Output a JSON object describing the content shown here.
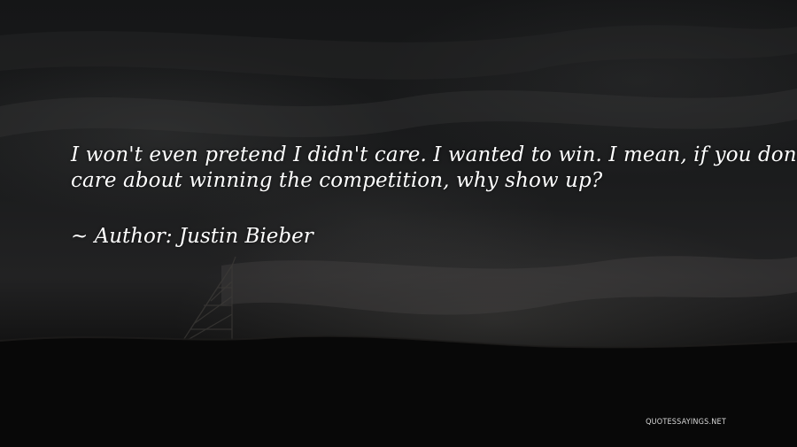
{
  "quote": {
    "lines": [
      "I won't even pretend I didn't care. I wanted to win. I mean, if you don't",
      "care about winning the competition, why show up?"
    ]
  },
  "author": {
    "text": "~ Author: Justin Bieber"
  },
  "watermark": {
    "text": "QUOTESSAYINGS.NET"
  }
}
